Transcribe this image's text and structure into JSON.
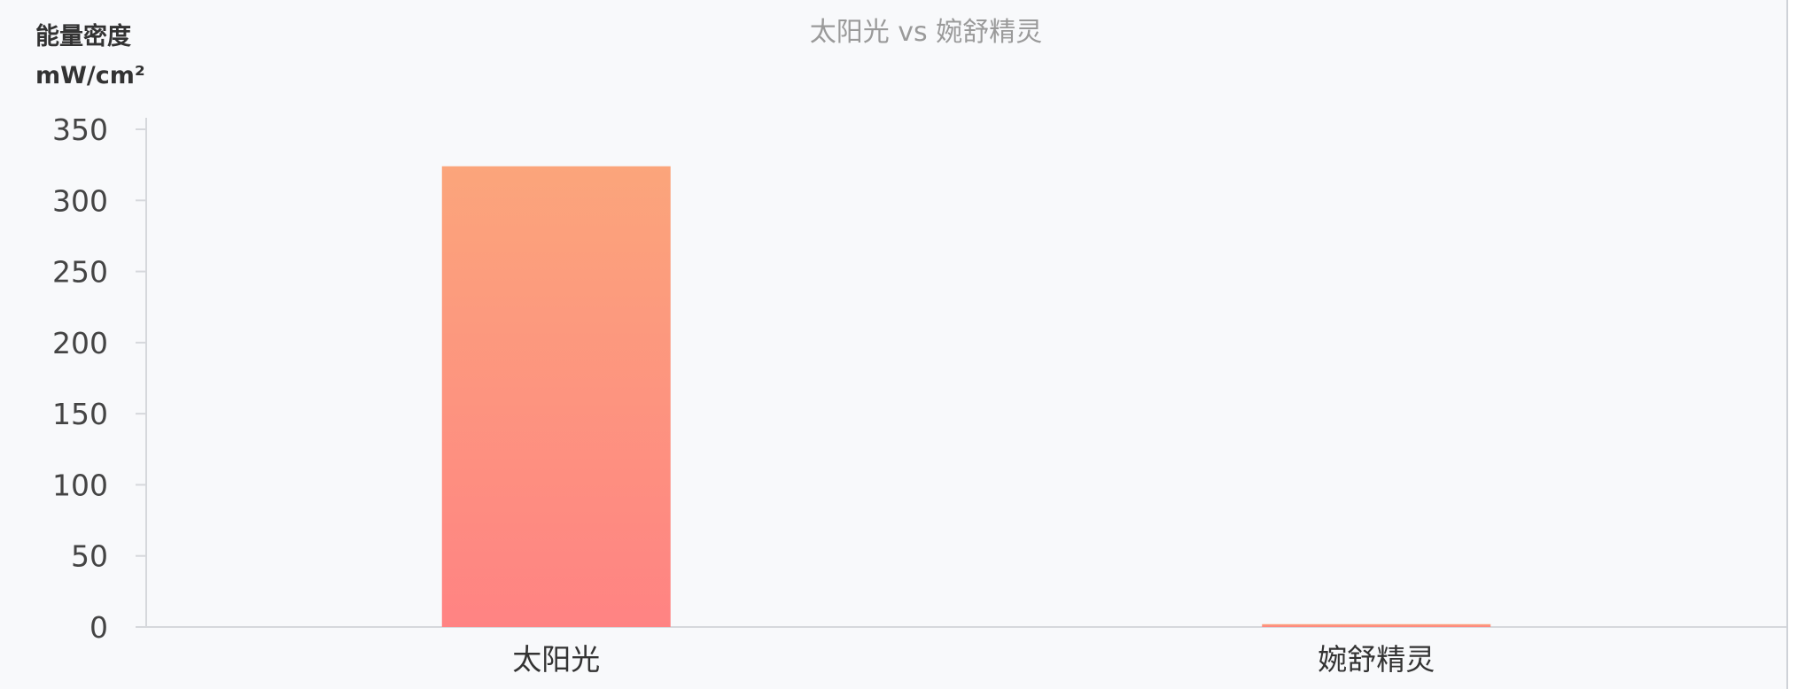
{
  "chart_data": {
    "type": "bar",
    "title": "太阳光 vs 婉舒精灵",
    "ylabel_line1": "能量密度",
    "ylabel_line2": "mW/cm²",
    "categories": [
      "太阳光",
      "婉舒精灵"
    ],
    "values": [
      324,
      2
    ],
    "ylim": [
      0,
      350
    ],
    "yticks": [
      0,
      50,
      100,
      150,
      200,
      250,
      300,
      350
    ],
    "grid": false,
    "legend": "none",
    "bar_gradient": {
      "top": "#fba57b",
      "bottom": "#ff8383"
    }
  }
}
